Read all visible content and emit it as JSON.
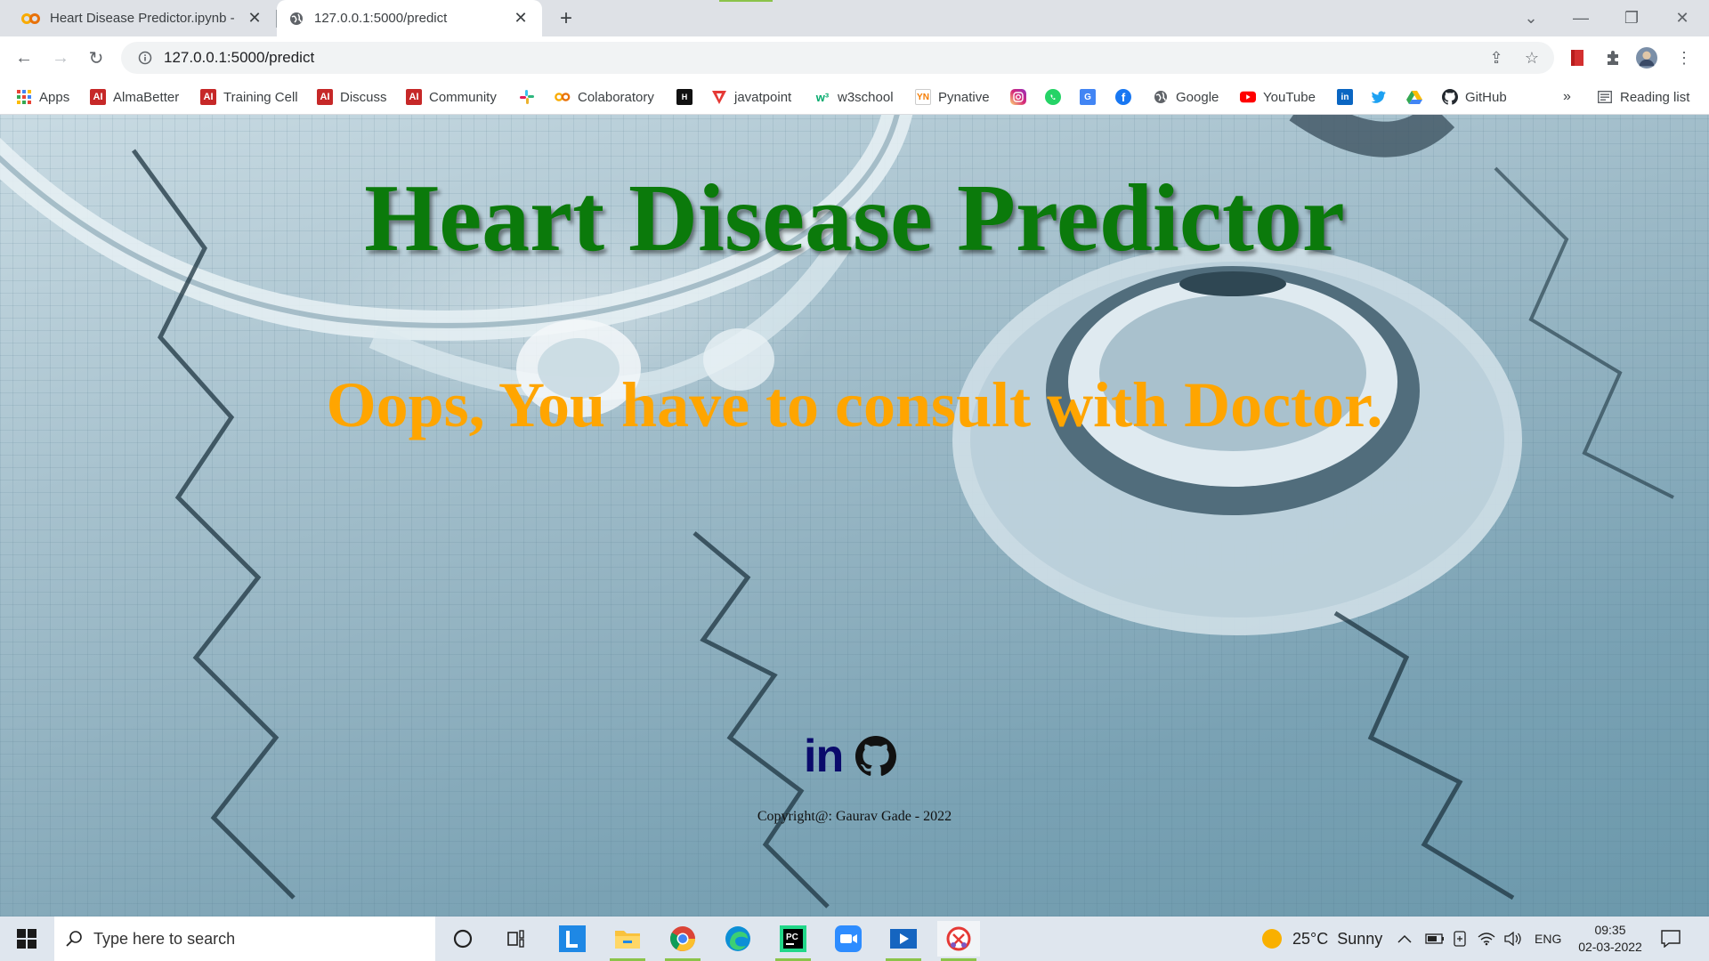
{
  "browser": {
    "tabs": [
      {
        "title": "Heart Disease Predictor.ipynb - Colaboratory",
        "icon": "colab-icon",
        "active": false
      },
      {
        "title": "127.0.0.1:5000/predict",
        "icon": "globe-icon",
        "active": true
      }
    ],
    "url": "127.0.0.1:5000/predict",
    "bookmarks": [
      {
        "label": "Apps",
        "icon": "apps-grid-icon"
      },
      {
        "label": "AlmaBetter",
        "icon": "almabetter-icon"
      },
      {
        "label": "Training Cell",
        "icon": "almabetter-icon"
      },
      {
        "label": "Discuss",
        "icon": "almabetter-icon"
      },
      {
        "label": "Community",
        "icon": "almabetter-icon"
      },
      {
        "label": "",
        "icon": "slack-icon"
      },
      {
        "label": "Colaboratory",
        "icon": "colab-icon"
      },
      {
        "label": "",
        "icon": "hackerrank-icon"
      },
      {
        "label": "javatpoint",
        "icon": "javatpoint-icon"
      },
      {
        "label": "w3school",
        "icon": "w3schools-icon"
      },
      {
        "label": "Pynative",
        "icon": "pynative-icon"
      },
      {
        "label": "",
        "icon": "instagram-icon"
      },
      {
        "label": "",
        "icon": "whatsapp-icon"
      },
      {
        "label": "",
        "icon": "google-translate-icon"
      },
      {
        "label": "",
        "icon": "facebook-icon"
      },
      {
        "label": "Google",
        "icon": "globe-icon"
      },
      {
        "label": "YouTube",
        "icon": "youtube-icon"
      },
      {
        "label": "",
        "icon": "linkedin-icon"
      },
      {
        "label": "",
        "icon": "twitter-icon"
      },
      {
        "label": "",
        "icon": "google-drive-icon"
      },
      {
        "label": "GitHub",
        "icon": "github-icon"
      }
    ],
    "bookmarks_overflow": "»",
    "reading_list": "Reading list"
  },
  "page": {
    "heading": "Heart Disease Predictor",
    "message": "Oops, You have to consult with Doctor.",
    "linkedin_text": "in",
    "copyright": "Copyright@: Gaurav Gade - 2022",
    "colors": {
      "heading": "#0b7a0b",
      "message": "#ffa500",
      "linkedin": "#0a0a6b"
    }
  },
  "taskbar": {
    "search_placeholder": "Type here to search",
    "weather": "25°C  Sunny",
    "language": "ENG",
    "time": "09:35",
    "date": "02-03-2022",
    "apps": [
      "cortana-icon",
      "task-view-icon",
      "l-app-icon",
      "file-explorer-icon",
      "chrome-icon",
      "edge-icon",
      "pycharm-icon",
      "zoom-icon",
      "media-player-icon",
      "snip-tool-icon"
    ]
  }
}
